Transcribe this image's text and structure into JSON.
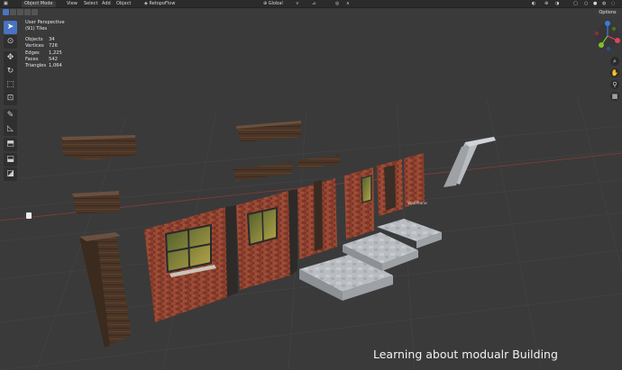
{
  "header": {
    "mode": "Object Mode",
    "menus": [
      "View",
      "Select",
      "Add",
      "Object"
    ],
    "addon": "RetopoFlow",
    "transform_orientation": "Global"
  },
  "viewport": {
    "view_name": "User Perspective",
    "collection": "(91) Tiles",
    "stats": [
      {
        "label": "Objects",
        "value": "34"
      },
      {
        "label": "Vertices",
        "value": "726"
      },
      {
        "label": "Edges",
        "value": "1,225"
      },
      {
        "label": "Faces",
        "value": "542"
      },
      {
        "label": "Triangles",
        "value": "1,064"
      }
    ],
    "options_label": "Options",
    "object_label": "WallPlane",
    "caption": "Learning about modualr  Building"
  },
  "toolbar": {
    "icons": [
      "select-box-icon",
      "cursor-icon",
      "move-icon",
      "rotate-icon",
      "scale-icon",
      "transform-icon",
      "annotate-icon",
      "measure-icon",
      "add-cube-icon",
      "extrude-icon",
      "inset-icon"
    ]
  },
  "colors": {
    "background": "#3a3a3a",
    "header": "#2b2b2b",
    "accent": "#4773c2",
    "axis_x": "#e0445a",
    "axis_y": "#7fbf2a",
    "axis_z": "#3a7be0"
  }
}
